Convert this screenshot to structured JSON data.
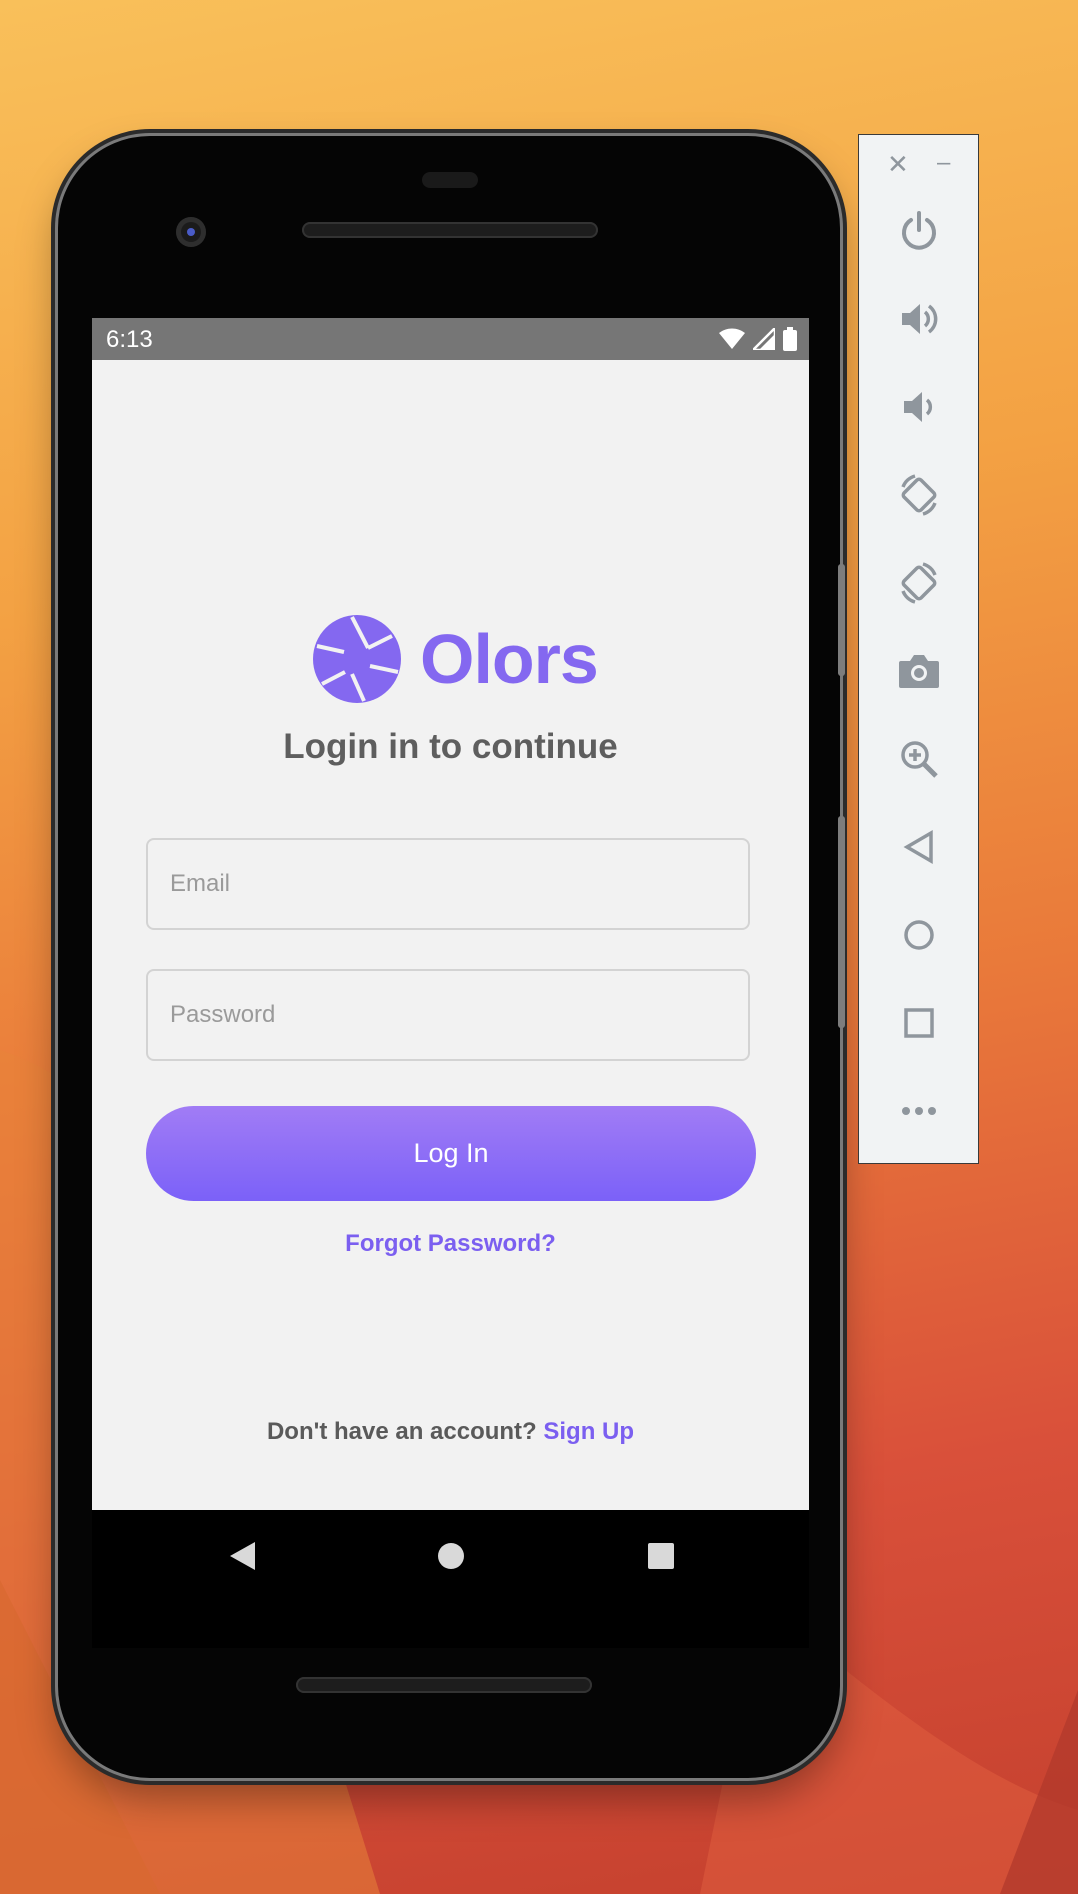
{
  "status_bar": {
    "time": "6:13"
  },
  "app": {
    "brand_name": "Olors",
    "heading": "Login in to continue",
    "email_placeholder": "Email",
    "email_value": "",
    "password_placeholder": "Password",
    "password_value": "",
    "login_label": "Log In",
    "forgot_label": "Forgot Password?",
    "signup_prompt": "Don't have an account? ",
    "signup_label": "Sign Up"
  },
  "colors": {
    "accent": "#7b5ff0",
    "button_top": "#a17cf5",
    "button_bottom": "#7b61f8",
    "status_bar": "#767676",
    "app_bg": "#f2f2f2",
    "toolbar_icon": "#8f969d"
  },
  "nav_icons": [
    "back-triangle-icon",
    "home-circle-icon",
    "recents-square-icon"
  ],
  "toolbar_icons": [
    "close-icon",
    "minimize-icon",
    "power-icon",
    "volume-up-icon",
    "volume-down-icon",
    "rotate-left-icon",
    "rotate-right-icon",
    "camera-icon",
    "zoom-icon",
    "back-icon",
    "home-icon",
    "overview-icon",
    "more-icon"
  ],
  "toolbar_text": {
    "close": "✕",
    "minimize": "–"
  }
}
